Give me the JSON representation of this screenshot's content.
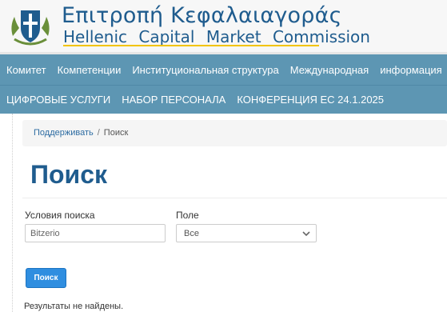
{
  "header": {
    "title_greek": "Επιτροπή Κεφαλαιαγοράς",
    "title_english": "Hellenic Capital Market Commission",
    "logo_icon": "greek-coat-of-arms-icon",
    "colors": {
      "brand": "#1f5c8e",
      "accent": "#f2c400",
      "nav": "#5d96b3"
    }
  },
  "nav": {
    "row1": [
      "Комитет",
      "Компетенции",
      "Институциональная структура",
      "Международная",
      "информация"
    ],
    "row2": [
      "ЦИФРОВЫЕ УСЛУГИ",
      "НАБОР ПЕРСОНАЛА",
      "КОНФЕРЕНЦИЯ ЕС 24.1.2025"
    ]
  },
  "breadcrumb": {
    "home": "Поддерживать",
    "current": "Поиск"
  },
  "page": {
    "title": "Поиск"
  },
  "form": {
    "terms_label": "Условия поиска",
    "terms_value": "Bitzerio",
    "field_label": "Поле",
    "field_value": "Все",
    "submit_label": "Поиск"
  },
  "results": {
    "message": "Результаты не найдены."
  }
}
